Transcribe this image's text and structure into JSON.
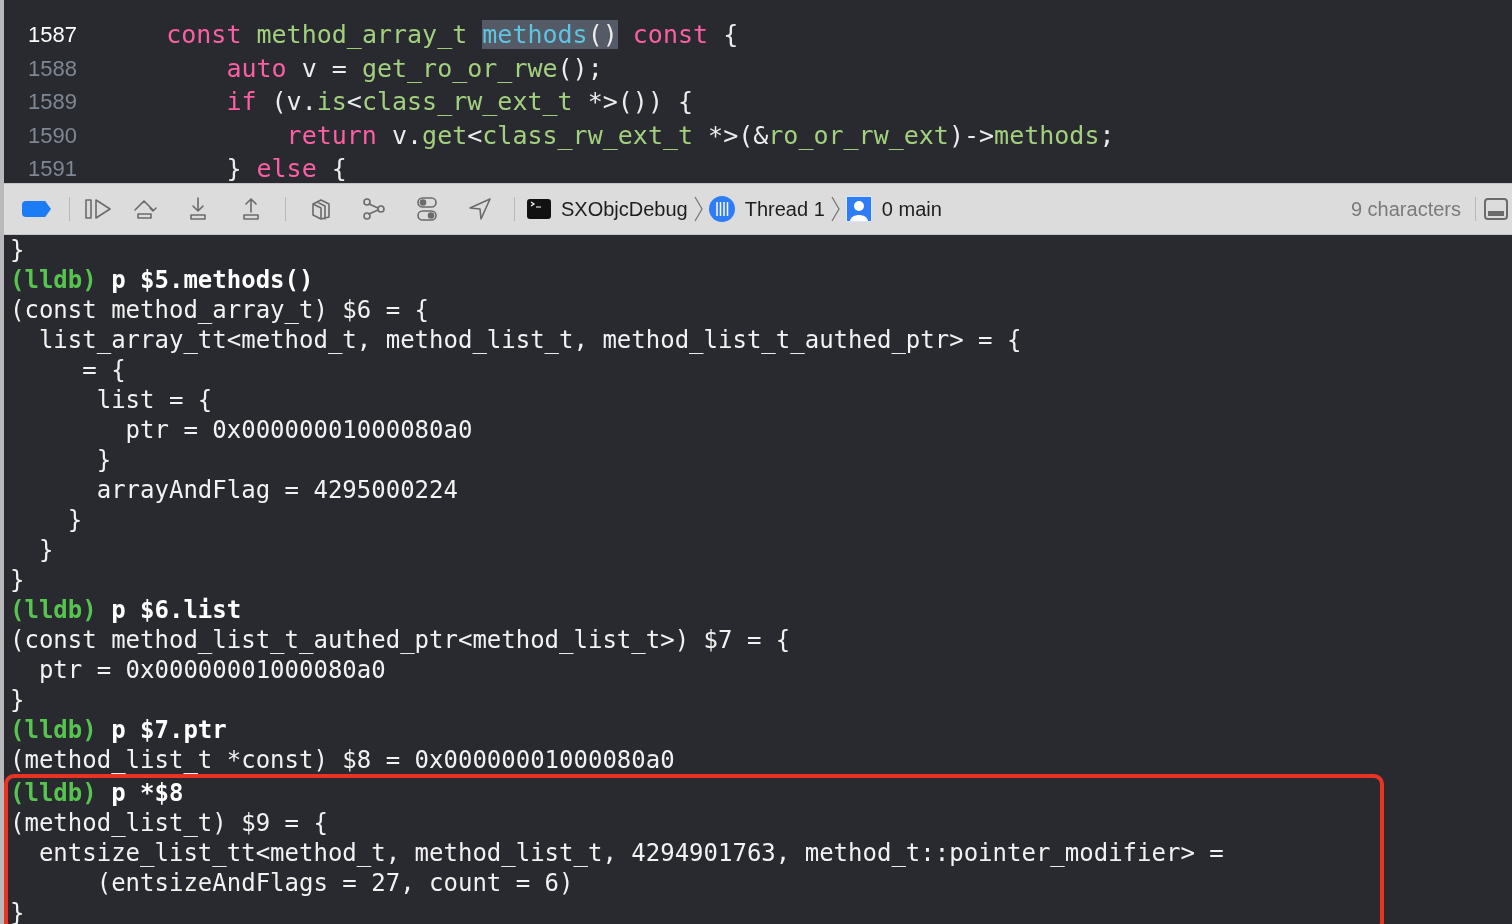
{
  "editor": {
    "lines": [
      {
        "number": "1587",
        "current": true,
        "tokens": [
          {
            "kind": "keyword",
            "text": "    const",
            "selected": false
          },
          {
            "kind": "type",
            "text": " method_array_t ",
            "selected": false
          },
          {
            "kind": "function",
            "text": "methods",
            "selected": true
          },
          {
            "kind": "plain",
            "text": "()",
            "selected": true
          },
          {
            "kind": "keyword",
            "text": " const",
            "selected": false
          },
          {
            "kind": "plain",
            "text": " {",
            "selected": false
          }
        ]
      },
      {
        "number": "1588",
        "current": false,
        "tokens": [
          {
            "kind": "keyword",
            "text": "        auto"
          },
          {
            "kind": "plain",
            "text": " v = "
          },
          {
            "kind": "type",
            "text": "get_ro_or_rwe"
          },
          {
            "kind": "plain",
            "text": "();"
          }
        ]
      },
      {
        "number": "1589",
        "current": false,
        "tokens": [
          {
            "kind": "keyword",
            "text": "        if"
          },
          {
            "kind": "plain",
            "text": " (v."
          },
          {
            "kind": "type",
            "text": "is"
          },
          {
            "kind": "plain",
            "text": "<"
          },
          {
            "kind": "type",
            "text": "class_rw_ext_t"
          },
          {
            "kind": "plain",
            "text": " *>()) {"
          }
        ]
      },
      {
        "number": "1590",
        "current": false,
        "tokens": [
          {
            "kind": "keyword",
            "text": "            return"
          },
          {
            "kind": "plain",
            "text": " v."
          },
          {
            "kind": "type",
            "text": "get"
          },
          {
            "kind": "plain",
            "text": "<"
          },
          {
            "kind": "type",
            "text": "class_rw_ext_t"
          },
          {
            "kind": "plain",
            "text": " *>(&"
          },
          {
            "kind": "type",
            "text": "ro_or_rw_ext"
          },
          {
            "kind": "plain",
            "text": ")->"
          },
          {
            "kind": "type",
            "text": "methods"
          },
          {
            "kind": "plain",
            "text": ";"
          }
        ]
      },
      {
        "number": "1591",
        "current": false,
        "tokens": [
          {
            "kind": "plain",
            "text": "        } "
          },
          {
            "kind": "keyword",
            "text": "else"
          },
          {
            "kind": "plain",
            "text": " {"
          }
        ]
      }
    ]
  },
  "debug_bar": {
    "breakpoints_active": true,
    "target": "SXObjcDebug",
    "thread": "Thread 1",
    "frame": "0 main",
    "selection_info": "9 characters"
  },
  "console": {
    "lines": [
      {
        "kind": "output",
        "text": "}",
        "outlined": false
      },
      {
        "kind": "command",
        "prompt": "(lldb)",
        "text": "p $5.methods()",
        "outlined": false
      },
      {
        "kind": "output",
        "text": "(const method_array_t) $6 = {",
        "outlined": false
      },
      {
        "kind": "output",
        "text": "  list_array_tt<method_t, method_list_t, method_list_t_authed_ptr> = {",
        "outlined": false
      },
      {
        "kind": "output",
        "text": "     = {",
        "outlined": false
      },
      {
        "kind": "output",
        "text": "      list = {",
        "outlined": false
      },
      {
        "kind": "output",
        "text": "        ptr = 0x00000001000080a0",
        "outlined": false
      },
      {
        "kind": "output",
        "text": "      }",
        "outlined": false
      },
      {
        "kind": "output",
        "text": "      arrayAndFlag = 4295000224",
        "outlined": false
      },
      {
        "kind": "output",
        "text": "    }",
        "outlined": false
      },
      {
        "kind": "output",
        "text": "  }",
        "outlined": false
      },
      {
        "kind": "output",
        "text": "}",
        "outlined": false
      },
      {
        "kind": "command",
        "prompt": "(lldb)",
        "text": "p $6.list",
        "outlined": false
      },
      {
        "kind": "output",
        "text": "(const method_list_t_authed_ptr<method_list_t>) $7 = {",
        "outlined": false
      },
      {
        "kind": "output",
        "text": "  ptr = 0x00000001000080a0",
        "outlined": false
      },
      {
        "kind": "output",
        "text": "}",
        "outlined": false
      },
      {
        "kind": "command",
        "prompt": "(lldb)",
        "text": "p $7.ptr",
        "outlined": false
      },
      {
        "kind": "output",
        "text": "(method_list_t *const) $8 = 0x00000001000080a0",
        "outlined": false
      },
      {
        "kind": "command",
        "prompt": "(lldb)",
        "text": "p *$8",
        "outlined": true
      },
      {
        "kind": "output",
        "text": "(method_list_t) $9 = {",
        "outlined": true
      },
      {
        "kind": "output",
        "text": "  entsize_list_tt<method_t, method_list_t, 4294901763, method_t::pointer_modifier> =",
        "outlined": true
      },
      {
        "kind": "output",
        "text": "      (entsizeAndFlags = 27, count = 6)",
        "outlined": true
      },
      {
        "kind": "output",
        "text": "}",
        "outlined": true
      }
    ]
  }
}
